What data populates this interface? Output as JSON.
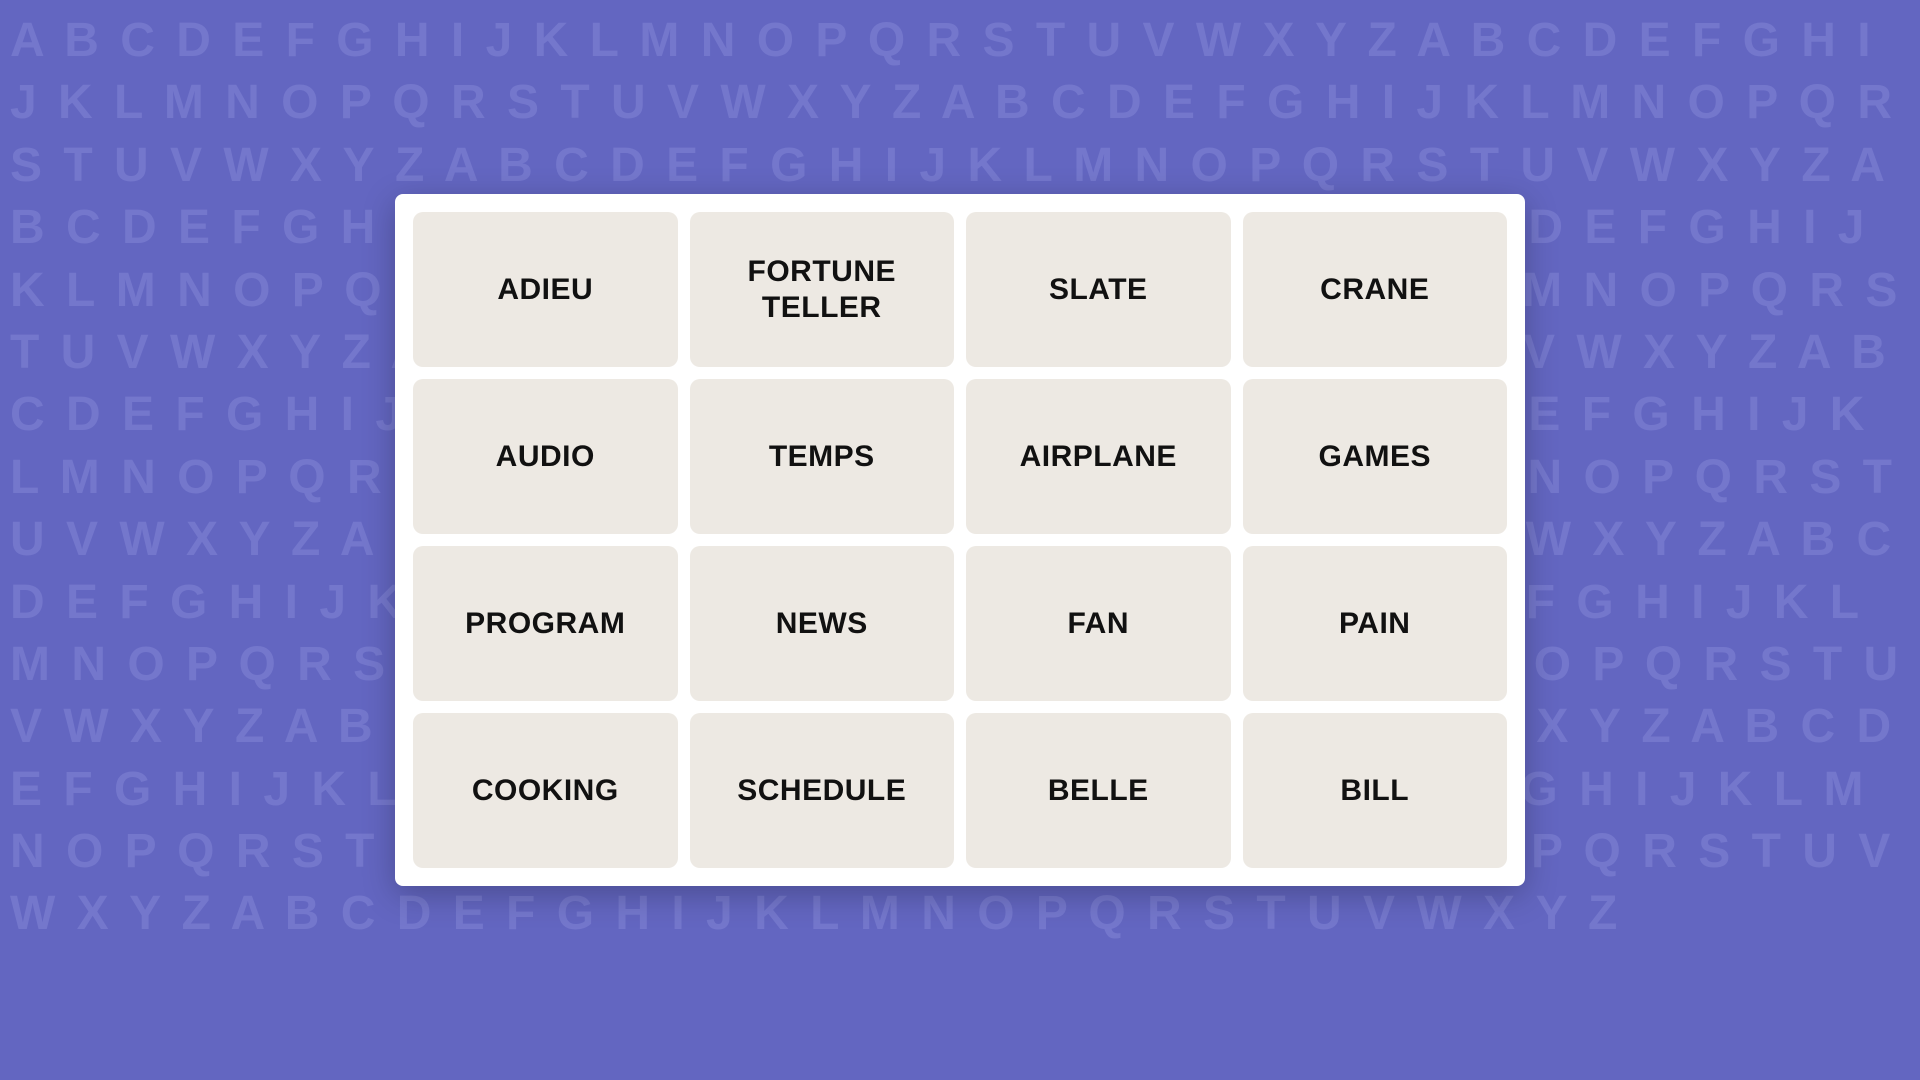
{
  "background": {
    "alphabet": "A B C D E F G H I J K L M N O P Q R S T U V W X Y Z A B C D E F G H I J K L M N O P Q R S T U V W X Y Z A B C D E F G H I J K L M N O P Q R S T U V W X Y Z A B C D E F G H I J K L M N O P Q R S T U V W X Y Z A B C D E F G H I J K L M N O P Q R S T U V W X Y Z A B C D E F G H I J K L M N O P Q R S T U V W X Y Z A B C D E F G H I J K L M N O P Q R S T U V W X Y Z A B C D E F G H I J K L M N O P Q R S T U V W X Y Z A B C D E F G H I J K L M N O P Q R S T U V W X Y Z A B C D E F G H I J K L M N O P Q R S T U V W X Y Z A B C D E F G H I J K L M N O P Q R S T U V W X Y Z A B C D E F G H I J K L M N O P Q R S T U V W X Y Z A B C D E F G H I J K L M N O P Q R S T U V W X Y Z A B C D E F G H I J K L M N O P Q R S T U V W X Y Z A B C D E F G H I J K L M N O P Q R S T U V W X Y Z A B C D E F G H I J K L M N O P Q R S T U V W X Y Z A B C D E F G H I J K L M N O P Q R S T U V W X Y Z A B C D E F G H I J K L M N O P Q R S T U V W X Y Z A B C D E F G H I J K L M N O P Q R S T U V W X Y Z A B C D E F G H I J K L M N O P Q R S T U V W X Y Z"
  },
  "grid": {
    "cards": [
      {
        "id": "adieu",
        "label": "ADIEU"
      },
      {
        "id": "fortune-teller",
        "label": "FORTUNE TELLER"
      },
      {
        "id": "slate",
        "label": "SLATE"
      },
      {
        "id": "crane",
        "label": "CRANE"
      },
      {
        "id": "audio",
        "label": "AUDIO"
      },
      {
        "id": "temps",
        "label": "TEMPS"
      },
      {
        "id": "airplane",
        "label": "AIRPLANE"
      },
      {
        "id": "games",
        "label": "GAMES"
      },
      {
        "id": "program",
        "label": "PROGRAM"
      },
      {
        "id": "news",
        "label": "NEWS"
      },
      {
        "id": "fan",
        "label": "FAN"
      },
      {
        "id": "pain",
        "label": "PAIN"
      },
      {
        "id": "cooking",
        "label": "COOKING"
      },
      {
        "id": "schedule",
        "label": "SCHEDULE"
      },
      {
        "id": "belle",
        "label": "BELLE"
      },
      {
        "id": "bill",
        "label": "BILL"
      }
    ]
  }
}
